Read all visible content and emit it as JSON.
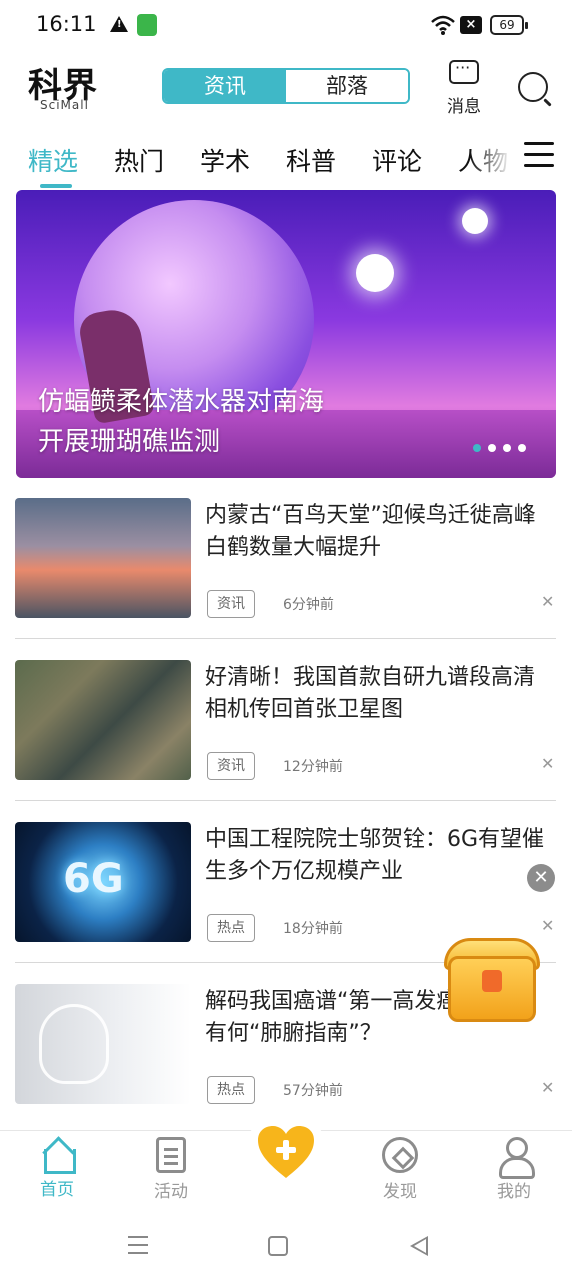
{
  "status_bar": {
    "time": "16:11",
    "battery": "69"
  },
  "header": {
    "logo_cn": "科界",
    "logo_en": "SciMall",
    "segment": [
      "资讯",
      "部落"
    ],
    "message_label": "消息"
  },
  "tabs": [
    "精选",
    "热门",
    "学术",
    "科普",
    "评论",
    "人物"
  ],
  "banner": {
    "caption_line1": "仿蝠鲼柔体潜水器对南海",
    "caption_line2": "开展珊瑚礁监测"
  },
  "news": [
    {
      "title": "内蒙古“百鸟天堂”迎候鸟迁徙高峰白鹤数量大幅提升",
      "tag": "资讯",
      "time": "6分钟前"
    },
    {
      "title": "好清晰！我国首款自研九谱段高清相机传回首张卫星图",
      "tag": "资讯",
      "time": "12分钟前"
    },
    {
      "title": "中国工程院院士邬贺铨：6G有望催生多个万亿规模产业",
      "tag": "热点",
      "time": "18分钟前",
      "thumb_text": "6G"
    },
    {
      "title": "解码我国癌谱“第一高发癌”，专家有何“肺腑指南”？",
      "tag": "热点",
      "time": "57分钟前"
    }
  ],
  "bottom_nav": [
    {
      "label": "首页"
    },
    {
      "label": "活动"
    },
    {
      "label": "发现"
    },
    {
      "label": "我的"
    }
  ],
  "colors": {
    "accent": "#3fb8c7",
    "heart": "#f7b51b"
  }
}
